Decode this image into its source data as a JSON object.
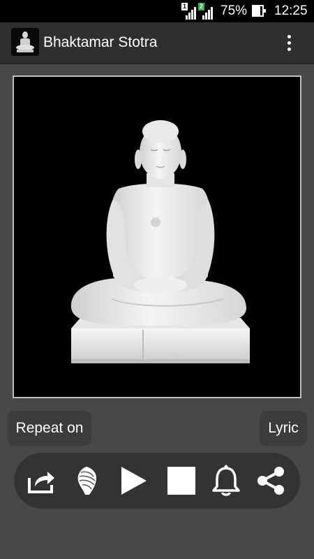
{
  "status_bar": {
    "sim1_label": "1",
    "sim2_label": "2",
    "battery_percent": "75%",
    "battery_level": 0.75,
    "time": "12:25"
  },
  "action_bar": {
    "title": "Bhaktamar Stotra",
    "app_icon": "jain-idol-icon",
    "overflow_icon": "more-vertical-icon"
  },
  "main_image": {
    "subject": "white marble seated Jain idol",
    "background_color": "#000000"
  },
  "buttons": {
    "repeat_label": "Repeat on",
    "lyric_label": "Lyric"
  },
  "controls": [
    {
      "name": "open-external-icon",
      "action": "open"
    },
    {
      "name": "conch-shell-icon",
      "action": "conch"
    },
    {
      "name": "play-icon",
      "action": "play"
    },
    {
      "name": "stop-icon",
      "action": "stop"
    },
    {
      "name": "bell-icon",
      "action": "bell"
    },
    {
      "name": "share-icon",
      "action": "share"
    }
  ],
  "colors": {
    "background": "#484848",
    "action_bar": "#2f2f2f",
    "button_bg": "#3c3c3c",
    "controls_bg": "#333333",
    "sim2_accent": "#34b34a"
  }
}
